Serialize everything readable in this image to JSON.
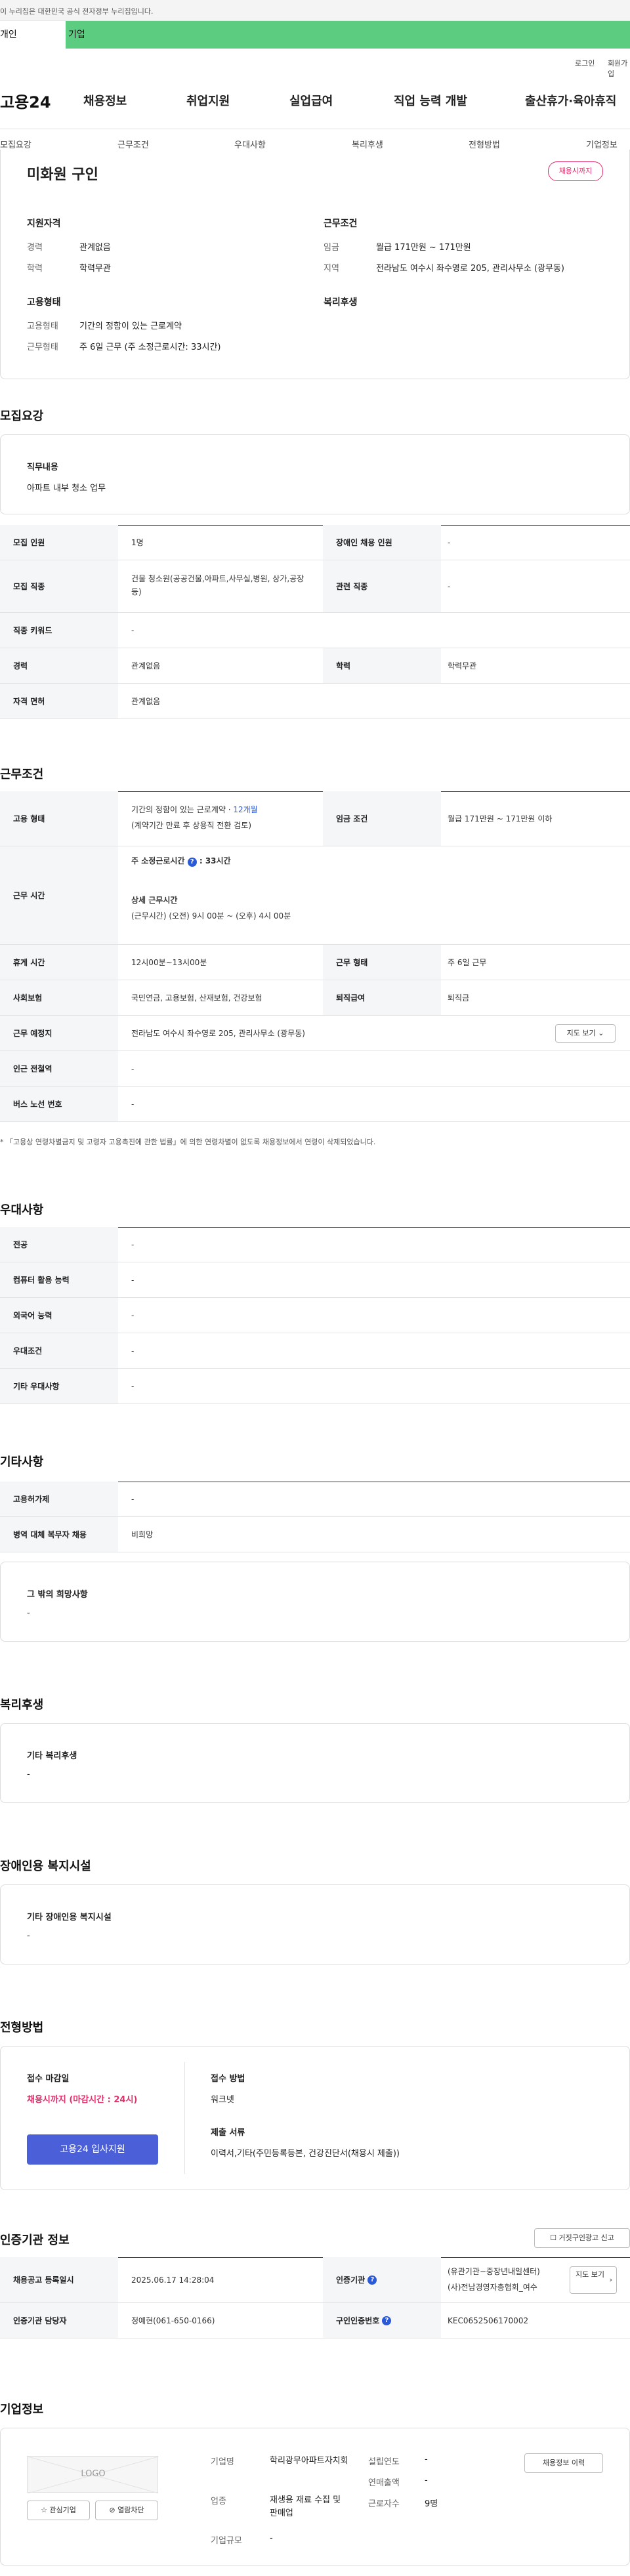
{
  "gov_notice": "이 누리집은 대한민국 공식 전자정부 누리집입니다.",
  "top_tabs": [
    "개인",
    "기업"
  ],
  "util_links": [
    "로그인",
    "회원가입"
  ],
  "gnb": {
    "logo": "고용24",
    "menus": [
      "채용정보",
      "취업지원",
      "실업급여",
      "직업 능력 개발",
      "출산휴가·육아휴직"
    ]
  },
  "anchor_tabs": [
    "모집요강",
    "근무조건",
    "우대사항",
    "복리후생",
    "전형방법",
    "기업정보"
  ],
  "header": {
    "title": "미화원 구인",
    "badge": "채용시까지"
  },
  "summary": {
    "qual_title": "지원자격",
    "exp_label": "경력",
    "exp_val": "관계없음",
    "edu_label": "학력",
    "edu_val": "학력무관",
    "work_title": "근무조건",
    "wage_label": "임금",
    "wage_val": "월급 171만원 ~ 171만원",
    "region_label": "지역",
    "region_val": "전라남도 여수시 좌수영로 205, 관리사무소 (광무동)",
    "emp_title": "고용형태",
    "emp_type_label": "고용형태",
    "emp_type_val": "기간의 정함이 있는 근로계약",
    "work_form_label": "근무형태",
    "work_form_val": "주 6일 근무 (주 소정근로시간: 33시간)",
    "welfare_title": "복리후생"
  },
  "recruit": {
    "section_title": "모집요강",
    "job_content_label": "직무내용",
    "job_content_val": "아파트 내부 청소 업무",
    "rows": {
      "count_label": "모집 인원",
      "count_val": "1명",
      "disabled_label": "장애인 채용 인원",
      "disabled_val": "-",
      "job_label": "모집 직종",
      "job_val": "건물 청소원(공공건물,아파트,사무실,병원, 상가,공장 등)",
      "related_label": "관련 직종",
      "related_val": "-",
      "keyword_label": "직종 키워드",
      "keyword_val": "-",
      "career_label": "경력",
      "career_val": "관계없음",
      "degree_label": "학력",
      "degree_val": "학력무관",
      "license_label": "자격 면허",
      "license_val": "관계없음"
    }
  },
  "conditions": {
    "section_title": "근무조건",
    "emp_label": "고용 형태",
    "emp_val": "기간의 정함이 있는 근로계약 · ",
    "emp_months": "12개월",
    "emp_note": "(계약기간 만료 후 상용직 전환 검토)",
    "wage_label": "임금 조건",
    "wage_val": "월급 171만원 ~ 171만원 이하",
    "hours_label": "근무 시간",
    "hours_weekly": "주 소정근로시간",
    "hours_weekly_val": ": 33시간",
    "hours_detail_title": "상세 근무시간",
    "hours_detail_val": "(근무시간) (오전) 9시 00분 ~ (오후) 4시 00분",
    "rest_label": "휴게 시간",
    "rest_val": "12시00분~13시00분",
    "form_label": "근무 형태",
    "form_val": "주 6일 근무",
    "insurance_label": "사회보험",
    "insurance_val": "국민연금, 고용보험, 산재보험, 건강보험",
    "retire_label": "퇴직급여",
    "retire_val": "퇴직금",
    "place_label": "근무 예정지",
    "place_val": "전라남도 여수시 좌수영로 205, 관리사무소 (광무동)",
    "map_btn": "지도 보기",
    "station_label": "인근 전철역",
    "station_val": "-",
    "bus_label": "버스 노선 번호",
    "bus_val": "-",
    "footnote": "* 「고용상 연령차별금지 및 고령자 고용촉진에 관한 법률」에 의한 연령차별이 없도록 채용정보에서 연령이 삭제되었습니다."
  },
  "prefer": {
    "section_title": "우대사항",
    "rows": [
      {
        "label": "전공",
        "val": "-"
      },
      {
        "label": "컴퓨터 활용 능력",
        "val": "-"
      },
      {
        "label": "외국어 능력",
        "val": "-"
      },
      {
        "label": "우대조건",
        "val": "-"
      },
      {
        "label": "기타 우대사항",
        "val": "-"
      }
    ]
  },
  "other": {
    "section_title": "기타사항",
    "rows": [
      {
        "label": "고용허가제",
        "val": "-"
      },
      {
        "label": "병역 대체 복무자 채용",
        "val": "비희망"
      }
    ],
    "other_wish_label": "그 밖의 희망사항",
    "other_wish_val": "-"
  },
  "welfare": {
    "section_title": "복리후생",
    "label": "기타 복리후생",
    "val": "-"
  },
  "disabled_facility": {
    "section_title": "장애인용 복지시설",
    "label": "기타 장애인용 복지시설",
    "val": "-"
  },
  "selection": {
    "section_title": "전형방법",
    "deadline_label": "접수 마감일",
    "deadline_val": "채용시까지 (마감시간 : 24시)",
    "apply_btn": "고용24 입사지원",
    "method_label": "접수 방법",
    "method_val": "워크넷",
    "docs_label": "제출 서류",
    "docs_val": "이력서,기타(주민등록등본, 건강진단서(채용시 제출))"
  },
  "cert": {
    "section_title": "인증기관 정보",
    "report_btn": "거짓구인광고 신고",
    "reg_label": "채용공고 등록일시",
    "reg_val": "2025.06.17 14:28:04",
    "agency_label": "인증기관",
    "agency_val_1": "(유관기관−중장년내일센터)",
    "agency_val_2": "(사)전남경영자총협회_여수",
    "map_btn": "지도 보기",
    "manager_label": "인증기관 담당자",
    "manager_val": "정예현(061-650-0166)",
    "job_no_label": "구인인증번호",
    "job_no_val": "KEC0652506170002"
  },
  "company": {
    "section_title": "기업정보",
    "logo_text": "LOGO",
    "interest_btn": "관심기업",
    "block_btn": "열람차단",
    "name_label": "기업명",
    "name_val": "학리광무아파트자치회",
    "industry_label": "업종",
    "industry_val": "재생용 재료 수집 및 판매업",
    "size_label": "기업규모",
    "size_val": "-",
    "founded_label": "설립연도",
    "founded_val": "-",
    "sales_label": "연매출액",
    "sales_val": "-",
    "employees_label": "근로자수",
    "employees_val": "9명",
    "history_btn": "채용정보 이력"
  },
  "colors": {
    "accent_green": "#5ccd80",
    "brand_blue": "#4a5fd8",
    "badge_pink": "#e0306a",
    "link_blue": "#2a5ad8",
    "deadline_red": "#e0306a"
  }
}
